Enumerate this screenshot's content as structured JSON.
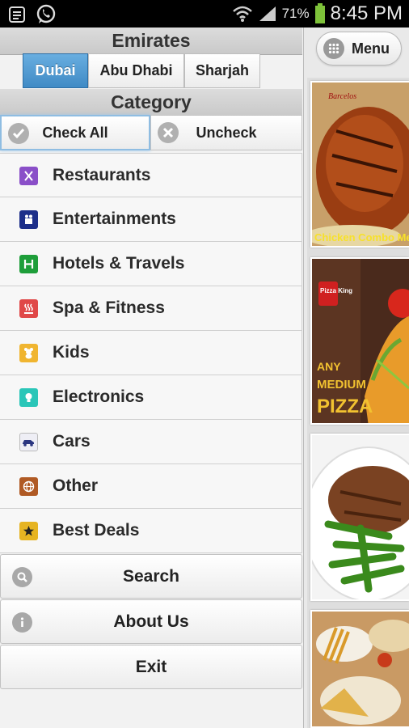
{
  "status": {
    "battery": "71%",
    "time": "8:45 PM"
  },
  "emirates": {
    "title": "Emirates",
    "tabs": [
      "Dubai",
      "Abu Dhabi",
      "Sharjah"
    ],
    "selected": "Dubai"
  },
  "category": {
    "title": "Category",
    "check_all": "Check All",
    "uncheck": "Uncheck",
    "items": [
      {
        "label": "Restaurants",
        "icon": "restaurant-icon",
        "color": "#8a4fc8"
      },
      {
        "label": "Entertainments",
        "icon": "entertainment-icon",
        "color": "#1d2f8a"
      },
      {
        "label": "Hotels & Travels",
        "icon": "hotel-icon",
        "color": "#1e9e3a"
      },
      {
        "label": "Spa & Fitness",
        "icon": "spa-icon",
        "color": "#e04848"
      },
      {
        "label": "Kids",
        "icon": "teddy-bear-icon",
        "color": "#f0b530"
      },
      {
        "label": "Electronics",
        "icon": "bulb-icon",
        "color": "#2ac6b8"
      },
      {
        "label": "Cars",
        "icon": "car-icon",
        "color": "#e8e8ef"
      },
      {
        "label": "Other",
        "icon": "globe-icon",
        "color": "#b05a24"
      },
      {
        "label": "Best Deals",
        "icon": "star-icon",
        "color": "#e6b422"
      }
    ]
  },
  "actions": {
    "search": "Search",
    "about": "About Us",
    "exit": "Exit"
  },
  "menu": {
    "label": "Menu"
  },
  "promos": [
    {
      "brand": "Barcelos",
      "caption": "Chicken Combo Meal"
    },
    {
      "brand": "Pizza King",
      "caption_line1": "ANY",
      "caption_line2": "MEDIUM",
      "caption_line3": "PIZZA"
    }
  ],
  "colors": {
    "accent": "#4a95d0",
    "status_bar": "#000000"
  }
}
